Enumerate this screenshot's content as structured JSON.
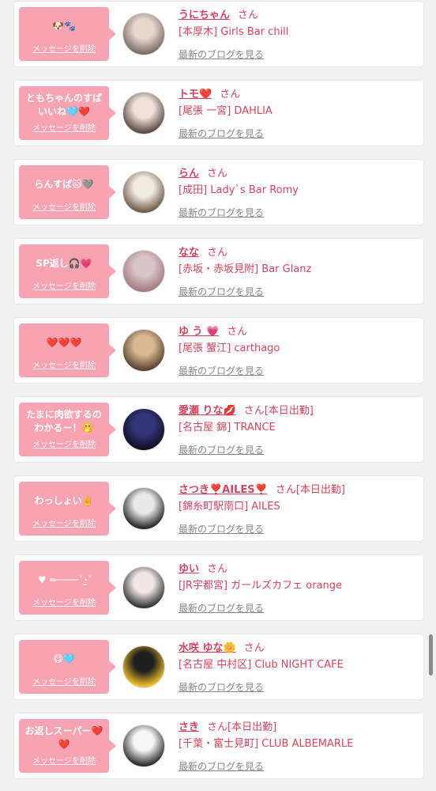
{
  "delete_label": "メッセージを削除",
  "blog_label": "最新のブログを見る",
  "san_label": "さん",
  "entries": [
    {
      "message": "🐶🐾",
      "name": "うにちゃん",
      "shift": "",
      "shop": "[本厚木] Girls Bar chill",
      "avatar_colors": [
        "#e6d8cf",
        "#7b6d66"
      ]
    },
    {
      "message": "ともちゃんのすば\nいいね🩵❤️",
      "name": "トモ❤️",
      "shift": "",
      "shop": "[尾張 一宮] DAHLIA",
      "avatar_colors": [
        "#efe1dc",
        "#5b4842"
      ]
    },
    {
      "message": "らんすぱ🐱🩶",
      "name": "らん",
      "shift": "",
      "shop": "[成田] Lady`s Bar Romy",
      "avatar_colors": [
        "#f1ebe4",
        "#6f5b48"
      ]
    },
    {
      "message": "SP返し🎧💗",
      "name": "なな",
      "shift": "",
      "shop": "[赤坂・赤坂見附] Bar Glanz",
      "avatar_colors": [
        "#d9c4c8",
        "#a27c80"
      ]
    },
    {
      "message": "❤️❤️❤️",
      "name": "ゆ う 💗",
      "shift": "",
      "shop": "[尾張 蟹江] carthago",
      "avatar_colors": [
        "#d8b993",
        "#5a4230"
      ]
    },
    {
      "message": "たまに肉欲するの\nわかるー！🤭",
      "name": "愛瀬 りな💋",
      "shift": "[本日出勤]",
      "shop": "[名古屋 錦] TRANCE",
      "avatar_colors": [
        "#35357a",
        "#101022"
      ]
    },
    {
      "message": "わっしょい✌️",
      "name": "さつき❣️AILES❣️",
      "shift": "[本日出勤]",
      "shop": "[錦糸町駅南口] AILES",
      "avatar_colors": [
        "#e9e9e9",
        "#262626"
      ]
    },
    {
      "message": "♥ ═──── ͛ ‧̫ ͛ ",
      "name": "ゆい",
      "shift": "",
      "shop": "[JR宇都宮] ガールズカフェ orange",
      "avatar_colors": [
        "#f0e6e6",
        "#343434"
      ]
    },
    {
      "message": "😋🩵",
      "name": "水咲 ゆな🌼",
      "shift": "",
      "shop": "[名古屋 中村区] Club NIGHT CAFE",
      "avatar_colors": [
        "#1f1f1f",
        "#f3c12a"
      ]
    },
    {
      "message": "お返しスーパー❤️\n❤️",
      "name": "さき",
      "shift": "[本日出勤]",
      "shop": "[千葉・富士見町] CLUB ALBEMARLE",
      "avatar_colors": [
        "#f6f6f6",
        "#2b2b2b"
      ]
    }
  ]
}
